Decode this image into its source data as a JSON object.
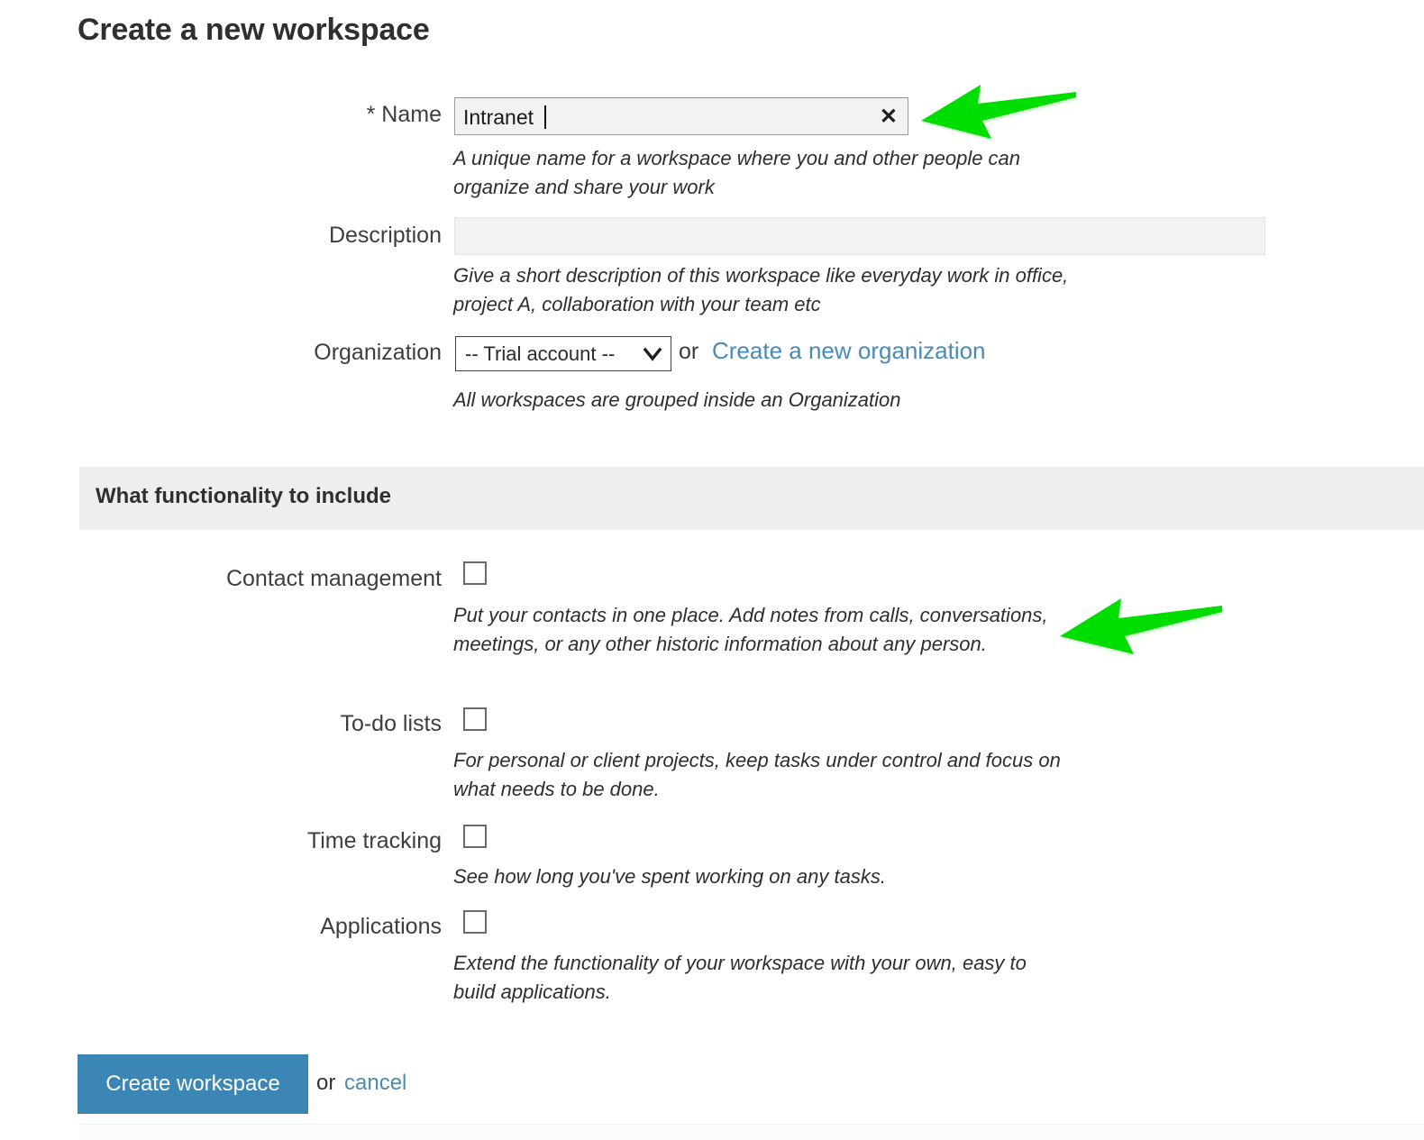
{
  "page": {
    "title": "Create a new workspace"
  },
  "form": {
    "name": {
      "label": "* Name",
      "value": "Intranet",
      "placeholder": "",
      "clear_icon": "close-icon",
      "help": "A unique name for a workspace where you and other people can organize and share your work"
    },
    "description": {
      "label": "Description",
      "value": "",
      "placeholder": "",
      "help": "Give a short description of this workspace like everyday work in office, project A, collaboration with your team etc"
    },
    "organization": {
      "label": "Organization",
      "selected": "-- Trial account --",
      "options": [
        "-- Trial account --"
      ],
      "or_text": "or",
      "link_text": "Create a new organization",
      "help": "All workspaces are grouped inside an Organization"
    }
  },
  "section": {
    "title": "What functionality to include",
    "items": [
      {
        "label": "Contact management",
        "checked": false,
        "help": "Put your contacts in one place. Add notes from calls, conversations, meetings, or any other historic information about any person."
      },
      {
        "label": "To-do lists",
        "checked": false,
        "help": "For personal or client projects, keep tasks under control and focus on what needs to be done."
      },
      {
        "label": "Time tracking",
        "checked": false,
        "help": "See how long you've spent working on any tasks."
      },
      {
        "label": "Applications",
        "checked": false,
        "help": "Extend the functionality of your workspace with your own, easy to build applications."
      }
    ]
  },
  "footer": {
    "submit_label": "Create workspace",
    "or_text": "or",
    "cancel_label": "cancel"
  },
  "colors": {
    "primary_button": "#3b86b4",
    "link": "#4a8bb5",
    "annotation_arrow": "#00dd00",
    "section_band": "#eeeeee"
  },
  "annotations": [
    {
      "name": "arrow-pointing-at-name-field",
      "direction": "left"
    },
    {
      "name": "arrow-pointing-at-contact-management",
      "direction": "left"
    }
  ]
}
